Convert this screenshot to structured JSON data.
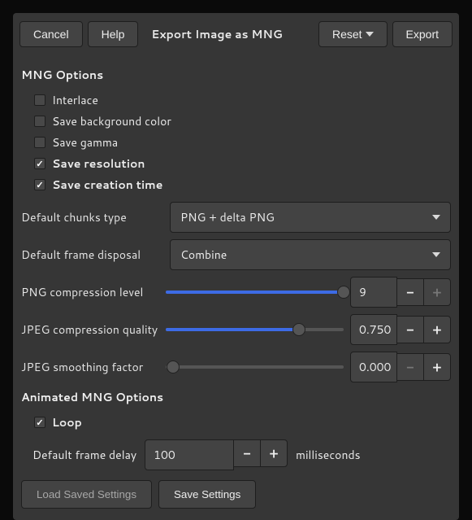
{
  "header": {
    "cancel": "Cancel",
    "help": "Help",
    "title": "Export Image as MNG",
    "reset": "Reset",
    "export": "Export"
  },
  "section1": {
    "title": "MNG Options",
    "interlace": "Interlace",
    "save_bg": "Save background color",
    "save_gamma": "Save gamma",
    "save_resolution": "Save resolution",
    "save_creation": "Save creation time"
  },
  "chunks": {
    "label": "Default chunks type",
    "value": "PNG + delta PNG"
  },
  "disposal": {
    "label": "Default frame disposal",
    "value": "Combine"
  },
  "png_comp": {
    "label": "PNG compression level",
    "value": "9",
    "pct": 100
  },
  "jpeg_q": {
    "label": "JPEG compression quality",
    "value": "0.750",
    "pct": 75
  },
  "jpeg_s": {
    "label": "JPEG smoothing factor",
    "value": "0.000",
    "pct": 0
  },
  "section2": {
    "title": "Animated MNG Options",
    "loop": "Loop"
  },
  "delay": {
    "label": "Default frame delay",
    "value": "100",
    "unit": "milliseconds"
  },
  "footer": {
    "load": "Load Saved Settings",
    "save": "Save Settings"
  }
}
